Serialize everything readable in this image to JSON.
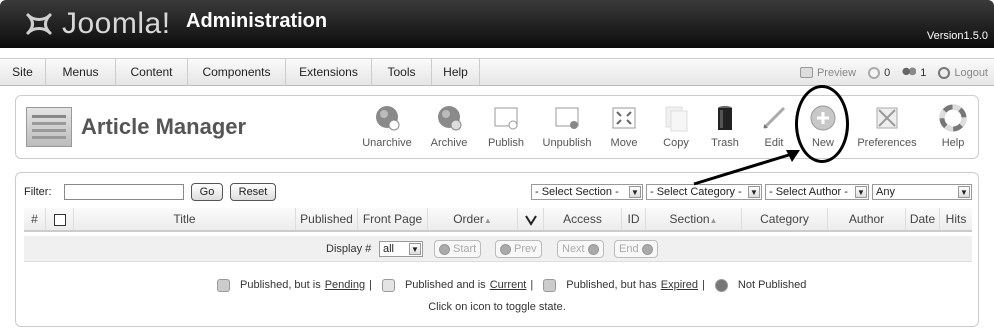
{
  "header": {
    "logo_text": "Joomla!",
    "admin_text": "Administration",
    "version": "Version1.5.0"
  },
  "menu": {
    "items": [
      "Site",
      "Menus",
      "Content",
      "Components",
      "Extensions",
      "Tools",
      "Help"
    ]
  },
  "menu_right": {
    "preview": "Preview",
    "messages_count": "0",
    "users_count": "1",
    "logout": "Logout"
  },
  "toolbar": {
    "title": "Article Manager",
    "buttons": [
      {
        "label": "Unarchive",
        "icon": "unarchive-icon"
      },
      {
        "label": "Archive",
        "icon": "archive-icon"
      },
      {
        "label": "Publish",
        "icon": "publish-icon"
      },
      {
        "label": "Unpublish",
        "icon": "unpublish-icon"
      },
      {
        "label": "Move",
        "icon": "move-icon"
      },
      {
        "label": "Copy",
        "icon": "copy-icon"
      },
      {
        "label": "Trash",
        "icon": "trash-icon"
      },
      {
        "label": "Edit",
        "icon": "edit-icon"
      },
      {
        "label": "New",
        "icon": "new-icon"
      },
      {
        "label": "Preferences",
        "icon": "preferences-icon"
      },
      {
        "label": "Help",
        "icon": "help-icon"
      }
    ]
  },
  "filter": {
    "label": "Filter:",
    "value": "",
    "go": "Go",
    "reset": "Reset",
    "section": "- Select Section -",
    "category": "- Select Category -",
    "author": "- Select Author -",
    "state": "Any"
  },
  "table": {
    "columns": [
      "#",
      "",
      "Title",
      "Published",
      "Front Page",
      "Order",
      "",
      "Access",
      "ID",
      "Section",
      "Category",
      "Author",
      "Date",
      "Hits"
    ]
  },
  "pagination": {
    "display_label": "Display #",
    "display_value": "all",
    "start": "Start",
    "prev": "Prev",
    "next": "Next",
    "end": "End"
  },
  "legend": {
    "pending_prefix": "Published, but is ",
    "pending_link": "Pending",
    "current_prefix": "Published and is ",
    "current_link": "Current",
    "expired_prefix": "Published, but has ",
    "expired_link": "Expired",
    "not_published": "Not Published",
    "sep": "|",
    "hint": "Click on icon to toggle state."
  }
}
